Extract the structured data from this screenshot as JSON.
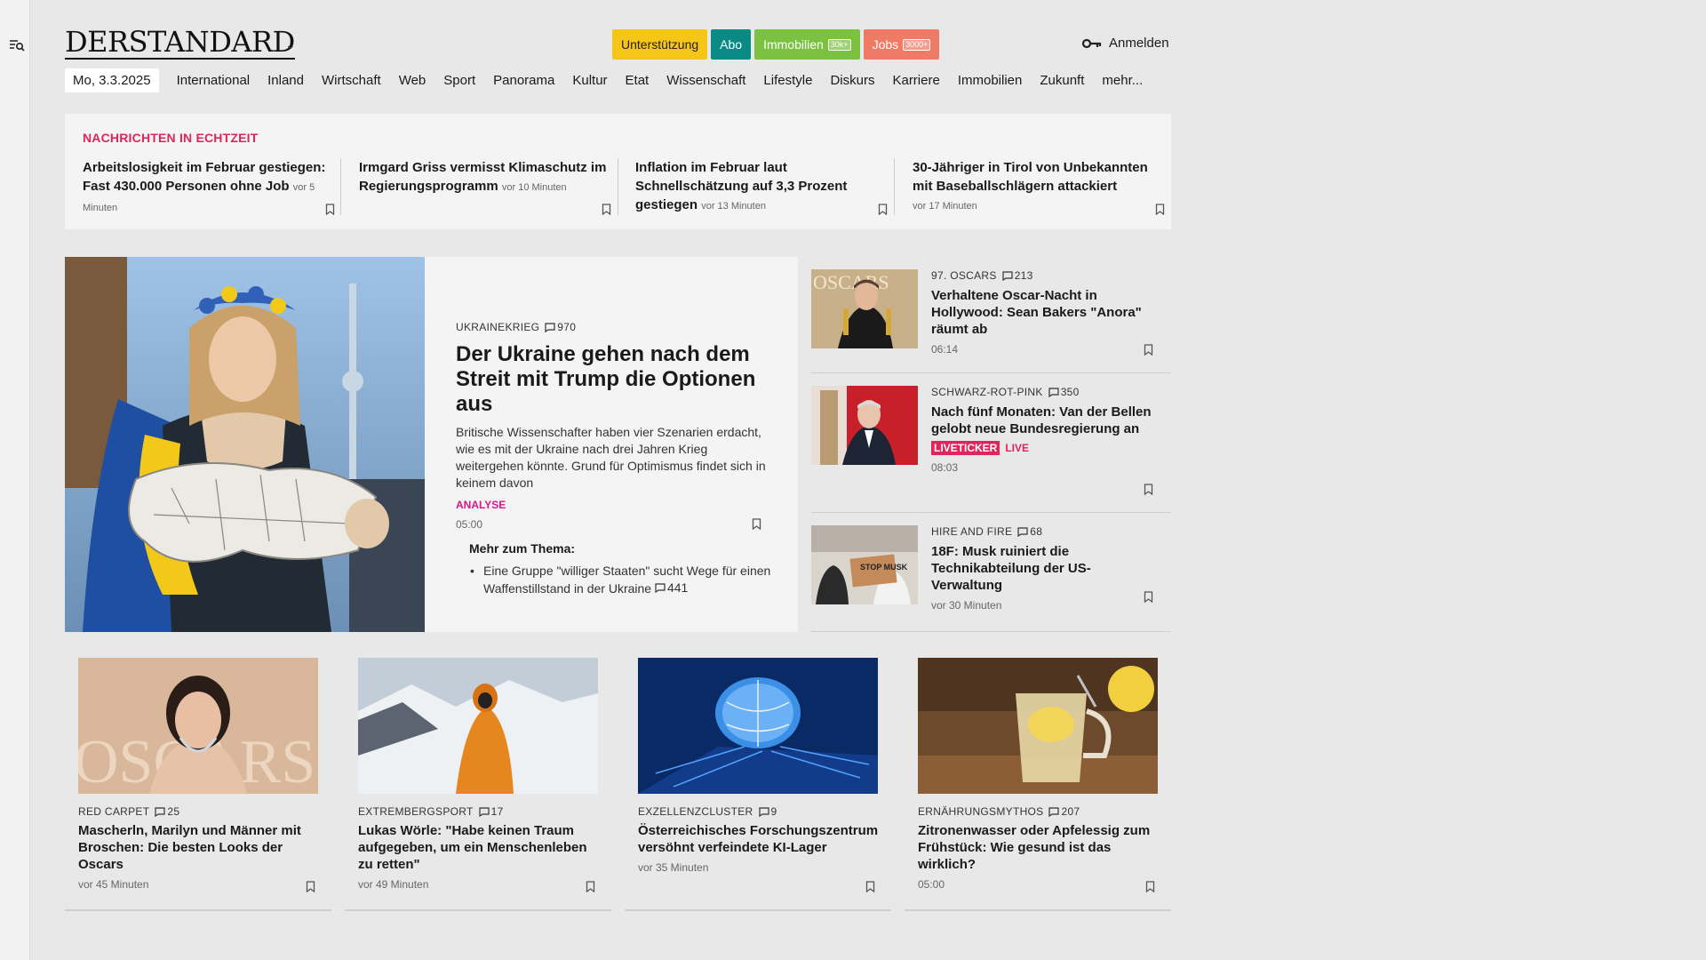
{
  "site": {
    "logo_text": "DERSTANDARD",
    "support_label": "Unterstützung",
    "abo_label": "Abo",
    "immo_label": "Immobilien",
    "immo_badge": "30k+",
    "jobs_label": "Jobs",
    "jobs_badge": "3000+",
    "login_label": "Anmelden"
  },
  "nav": {
    "date": "Mo, 3.3.2025",
    "items": [
      "International",
      "Inland",
      "Wirtschaft",
      "Web",
      "Sport",
      "Panorama",
      "Kultur",
      "Etat",
      "Wissenschaft",
      "Lifestyle",
      "Diskurs",
      "Karriere",
      "Immobilien",
      "Zukunft",
      "mehr..."
    ]
  },
  "live": {
    "title": "NACHRICHTEN IN ECHTZEIT",
    "items": [
      {
        "headline": "Arbeitslosigkeit im Februar gestiegen: Fast 430.000 Personen ohne Job",
        "ago": "vor 5 Minuten"
      },
      {
        "headline": "Irmgard Griss vermisst Klimaschutz im Regierungsprogramm",
        "ago": "vor 10 Minuten"
      },
      {
        "headline": "Inflation im Februar laut Schnellschätzung auf 3,3 Prozent gestiegen",
        "ago": "vor 13 Minuten"
      },
      {
        "headline": "30-Jähriger in Tirol von Unbekannten mit Baseballschlägern attackiert",
        "ago": "vor 17 Minuten"
      }
    ]
  },
  "lead": {
    "kicker": "UKRAINEKRIEG",
    "comments": "970",
    "title": "Der Ukraine gehen nach dem Streit mit Trump die Optionen aus",
    "text": "Britische Wissenschafter haben vier Szenarien erdacht, wie es mit der Ukraine nach drei Jahren Krieg weitergehen könnte. Grund für Optimismus findet sich in keinem davon",
    "label": "ANALYSE",
    "time": "05:00",
    "more_title": "Mehr zum Thema:",
    "more_item": "Eine Gruppe \"williger Staaten\" sucht Wege für einen Waffenstillstand in der Ukraine",
    "more_comments": "441"
  },
  "side": [
    {
      "kicker": "97. OSCARS",
      "comments": "213",
      "title": "Verhaltene Oscar-Nacht in Hollywood: Sean Bakers \"Anora\" räumt ab",
      "time": "06:14"
    },
    {
      "kicker": "SCHWARZ-ROT-PINK",
      "comments": "350",
      "title": "Nach fünf Monaten: Van der Bellen gelobt neue Bundesregierung an",
      "badge": "LIVETICKER",
      "live": "LIVE",
      "time": "08:03"
    },
    {
      "kicker": "HIRE AND FIRE",
      "comments": "68",
      "title": "18F: Musk ruiniert die Technikabteilung der US-Verwaltung",
      "time": "vor 30 Minuten"
    }
  ],
  "teasers": [
    {
      "kicker": "RED CARPET",
      "comments": "25",
      "title": "Mascherln, Marilyn und Männer mit Broschen: Die besten Looks der Oscars",
      "time": "vor 45 Minuten"
    },
    {
      "kicker": "EXTREMBERGSPORT",
      "comments": "17",
      "title": "Lukas Wörle: \"Habe keinen Traum aufgegeben, um ein Menschenleben zu retten\"",
      "time": "vor 49 Minuten"
    },
    {
      "kicker": "EXZELLENZCLUSTER",
      "comments": "9",
      "title": "Österreichisches Forschungszentrum versöhnt verfeindete KI-Lager",
      "time": "vor 35 Minuten"
    },
    {
      "kicker": "ERNÄHRUNGSMYTHOS",
      "comments": "207",
      "title": "Zitronenwasser oder Apfelessig zum Frühstück: Wie gesund ist das wirklich?",
      "time": "05:00"
    }
  ],
  "image_overlays": {
    "oscars_wall": "OSCARS",
    "protest_sign": "STOP MUSK"
  }
}
